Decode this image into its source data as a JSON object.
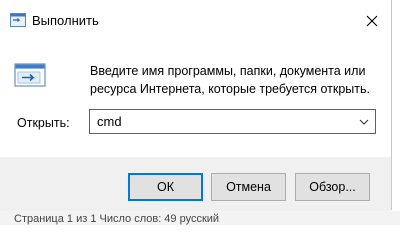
{
  "window": {
    "title": "Выполнить",
    "description": "Введите имя программы, папки, документа или ресурса Интернета, которые требуется открыть.",
    "open_label": "Открыть:",
    "command_value": "cmd"
  },
  "buttons": {
    "ok": "ОК",
    "cancel": "Отмена",
    "browse": "Обзор..."
  },
  "status_bar": {
    "text": "Страница 1 из 1     Число слов: 49     русский"
  },
  "colors": {
    "accent": "#0078d7",
    "footer_bg": "#f0f0f0",
    "button_bg": "#e1e1e1"
  },
  "icons": {
    "title": "run-dialog-icon",
    "body": "run-dialog-large-icon",
    "close": "close-icon",
    "dropdown": "chevron-down-icon"
  }
}
